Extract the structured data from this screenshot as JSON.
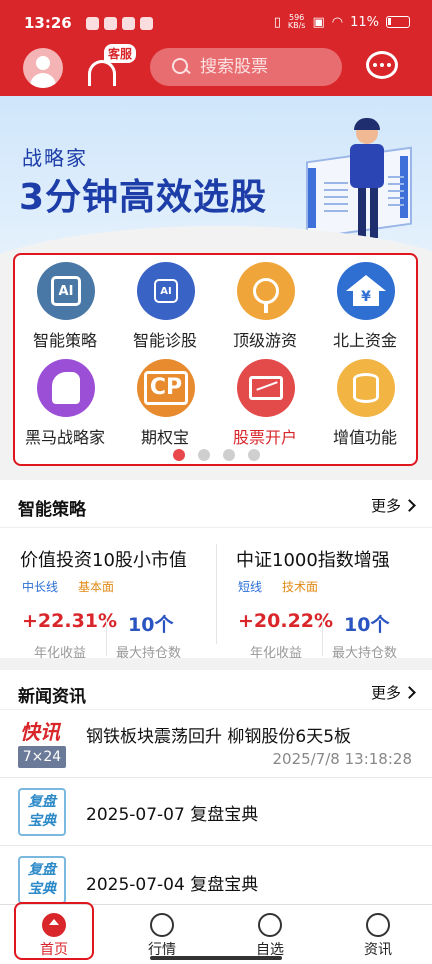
{
  "status": {
    "time": "13:26",
    "net_speed": "596\nKB/s",
    "battery": "11%"
  },
  "header": {
    "cs_badge": "客服",
    "search_placeholder": "搜索股票"
  },
  "banner": {
    "subtitle": "战略家",
    "title": "3分钟高效选股"
  },
  "functions": [
    {
      "label": "智能策略",
      "icon": "ai-chip-icon",
      "color": "#4a78a6"
    },
    {
      "label": "智能诊股",
      "icon": "ai-diagnose-icon",
      "color": "#3a63c6"
    },
    {
      "label": "顶级游资",
      "icon": "search-hot-money-icon",
      "color": "#f0a53a"
    },
    {
      "label": "北上资金",
      "icon": "north-fund-icon",
      "color": "#2f6fd1"
    },
    {
      "label": "黑马战略家",
      "icon": "dark-horse-icon",
      "color": "#9b4fd6"
    },
    {
      "label": "期权宝",
      "icon": "option-icon",
      "color": "#e88a2e"
    },
    {
      "label": "股票开户",
      "icon": "open-account-icon",
      "color": "#e34a4a"
    },
    {
      "label": "增值功能",
      "icon": "value-added-icon",
      "color": "#f2b442"
    }
  ],
  "page_dots": {
    "active": 1,
    "total": 4
  },
  "strategy": {
    "title": "智能策略",
    "more": "更多",
    "items": [
      {
        "name": "价值投资10股小市值",
        "tag1": "中长线",
        "tag2": "基本面",
        "return": "+22.31%",
        "holdings": "10个",
        "return_label": "年化收益",
        "holdings_label": "最大持仓数"
      },
      {
        "name": "中证1000指数增强",
        "tag1": "短线",
        "tag2": "技术面",
        "return": "+20.22%",
        "holdings": "10个",
        "return_label": "年化收益",
        "holdings_label": "最大持仓数"
      }
    ]
  },
  "news": {
    "title": "新闻资讯",
    "more": "更多",
    "flash_logo": "快讯",
    "flash_sub": "7×24",
    "review_logo": "复盘\n宝典",
    "items": [
      {
        "title": "钢铁板块震荡回升 柳钢股份6天5板",
        "time": "2025/7/8 13:18:28"
      },
      {
        "title": "2025-07-07 复盘宝典"
      },
      {
        "title": "2025-07-04 复盘宝典"
      }
    ]
  },
  "tabs": [
    "首页",
    "行情",
    "自选",
    "资讯"
  ]
}
